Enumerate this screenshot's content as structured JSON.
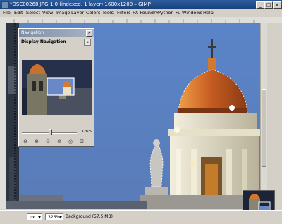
{
  "window": {
    "title": "*DSC00268.JPG-1.0 (indexed, 1 layer) 1600x1200 – GIMP",
    "minimize": "_",
    "maximize": "□",
    "close": "×"
  },
  "menu": [
    "File",
    "Edit",
    "Select",
    "View",
    "Image",
    "Layer",
    "Colors",
    "Tools",
    "Filters",
    "FX-Foundry",
    "Python-Fu",
    "Windows",
    "Help"
  ],
  "navigation": {
    "title": "Navigation",
    "close": "×",
    "subtitle": "Display Navigation",
    "menu_arrow": "◂",
    "zoom": "326%",
    "zoom_level": 0.5
  },
  "status": {
    "unit": "px",
    "zoom": "326%",
    "text": "Background (57,5 MB)"
  },
  "colors": {
    "sky": "#5b80c4",
    "dome": "#d9772a",
    "tower": "#e9e4cf"
  }
}
